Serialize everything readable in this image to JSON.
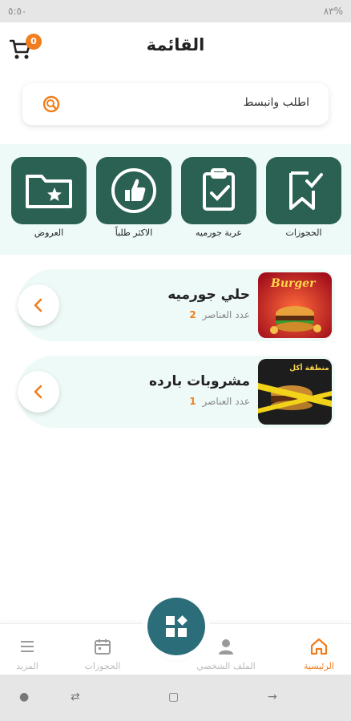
{
  "status_bar": {
    "left": "٥:٥٠",
    "right": "٨٣%"
  },
  "header": {
    "title": "القائمة",
    "cart_count": "0"
  },
  "search": {
    "placeholder": "اطلب وانبسط"
  },
  "categories": [
    {
      "label": "الحجوزات",
      "icon": "bookmark-check-icon"
    },
    {
      "label": "عربة جورميه",
      "icon": "clipboard-check-icon"
    },
    {
      "label": "الاكثر طلباً",
      "icon": "thumbs-up-icon"
    },
    {
      "label": "العروض",
      "icon": "folder-star-icon"
    }
  ],
  "menu_items": [
    {
      "title": "حلي جورميه",
      "count_label": "عدد العناصر",
      "count": "2",
      "image_text": "Burger"
    },
    {
      "title": "مشروبات بارده",
      "count_label": "عدد العناصر",
      "count": "1",
      "image_text": "منطقة أكل"
    }
  ],
  "bottom_nav": [
    {
      "label": "الرئيسية",
      "icon": "home-icon",
      "active": true
    },
    {
      "label": "الملف الشخصي",
      "icon": "person-icon",
      "active": false
    },
    {
      "label": "الحجوزات",
      "icon": "calendar-icon",
      "active": false
    },
    {
      "label": "المزيد",
      "icon": "menu-lines-icon",
      "active": false
    }
  ],
  "colors": {
    "primary": "#2a6152",
    "accent": "#f07e1e",
    "fab": "#2b6e7a",
    "band": "#eefaf8"
  }
}
